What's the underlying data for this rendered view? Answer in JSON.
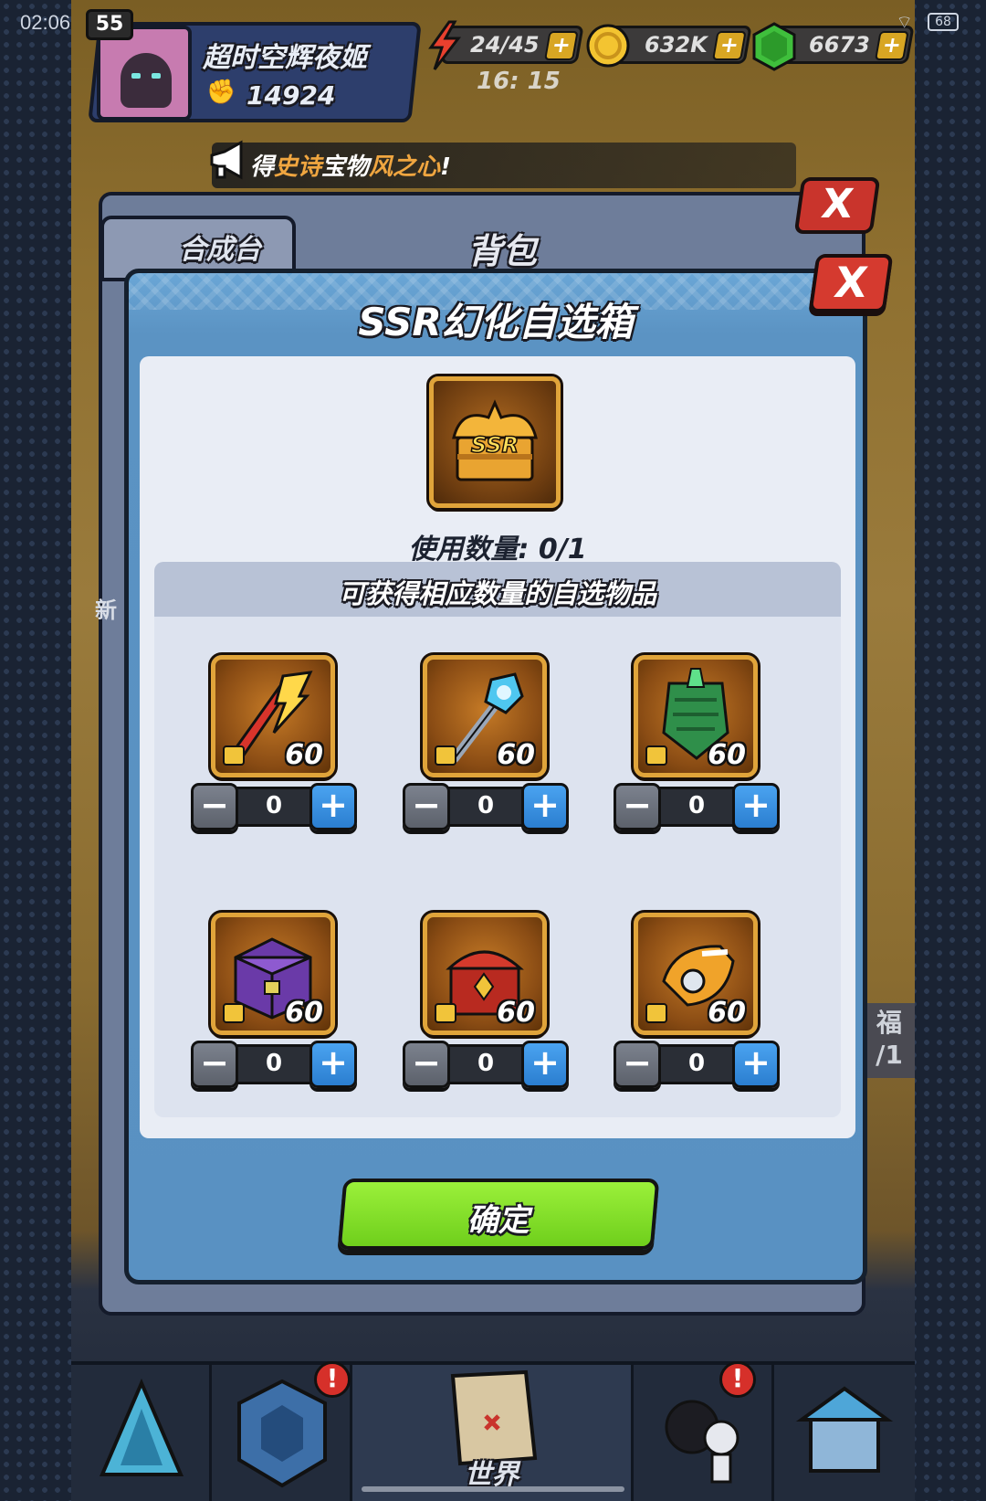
{
  "status_bar": {
    "time": "02:06",
    "battery": "68"
  },
  "player": {
    "level": "55",
    "name": "超时空辉夜姬",
    "power": "14924"
  },
  "resources": {
    "energy": "24/45",
    "energy_timer": "16: 15",
    "gold": "632K",
    "gems": "6673",
    "plus": "+"
  },
  "broadcast": {
    "prefix": "得",
    "rarity": "史诗",
    "middle": "宝物",
    "item": "风之心",
    "suffix": "!"
  },
  "background_panel": {
    "tab_label": "合成台",
    "title": "背包",
    "close": "X",
    "side_label": "新",
    "side_button": "福",
    "side_button_sub": "/1"
  },
  "modal": {
    "title": "SSR幻化自选箱",
    "close": "X",
    "box_badge": "SSR",
    "use_count_label": "使用数量: 0/1",
    "subheader": "可获得相应数量的自选物品",
    "items": [
      {
        "name": "lightning-spear",
        "qty": "60",
        "count": "0"
      },
      {
        "name": "ice-staff",
        "qty": "60",
        "count": "0"
      },
      {
        "name": "green-scale-shield",
        "qty": "60",
        "count": "0"
      },
      {
        "name": "purple-chest",
        "qty": "60",
        "count": "0"
      },
      {
        "name": "red-chest",
        "qty": "60",
        "count": "0"
      },
      {
        "name": "golden-gauntlet",
        "qty": "60",
        "count": "0"
      }
    ],
    "minus": "−",
    "plus": "+",
    "confirm": "确定"
  },
  "nav": {
    "world_label": "世界",
    "badge": "!"
  },
  "colors": {
    "modal_blue": "#5f98c7",
    "confirm_green": "#7fe02a",
    "plus_blue": "#2b7ed0",
    "item_border": "#e0a43a",
    "close_red": "#d53a2f"
  }
}
